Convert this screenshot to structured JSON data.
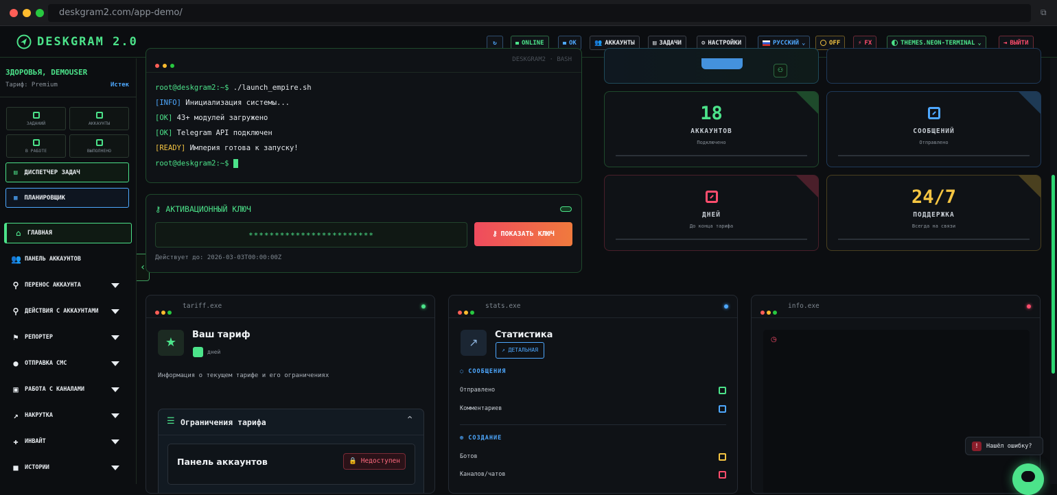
{
  "browser": {
    "url": "deskgram2.com/app-demo/"
  },
  "app": {
    "logo_text": "DESKGRAM 2.0"
  },
  "header": {
    "online": "ONLINE",
    "ok": "OK",
    "accounts": "АККАУНТЫ",
    "tasks": "ЗАДАЧИ",
    "settings": "НАСТРОЙКИ",
    "language": "РУССКИЙ",
    "off": "OFF",
    "fx": "FX",
    "theme": "THEMES.NEON-TERMINAL",
    "logout": "ВЫЙТИ"
  },
  "sidebar": {
    "greeting": "ЗДОРОВЬЯ, DEMOUSER",
    "plan": "Тариф: Premium",
    "plan_link": "Истек",
    "stats": [
      {
        "label": "ЗАДАНИЙ"
      },
      {
        "label": "АККАУНТЫ"
      },
      {
        "label": "В РАБОТЕ"
      },
      {
        "label": "ВЫПОЛНЕНО"
      }
    ],
    "dispatcher": "ДИСПЕТЧЕР ЗАДАЧ",
    "scheduler": "ПЛАНИРОВЩИК",
    "nav": [
      {
        "label": "ГЛАВНАЯ",
        "icon": "home-icon"
      },
      {
        "label": "ПАНЕЛЬ АККАУНТОВ",
        "icon": "users-icon"
      },
      {
        "label": "ПЕРЕНОС АККАУНТА",
        "icon": "user-transfer-icon"
      },
      {
        "label": "ДЕЙСТВИЯ С АККАУНТАМИ",
        "icon": "user-minus-icon"
      },
      {
        "label": "РЕПОРТЕР",
        "icon": "flag-icon"
      },
      {
        "label": "ОТПРАВКА СМС",
        "icon": "chat-icon"
      },
      {
        "label": "РАБОТА С КАНАЛАМИ",
        "icon": "briefcase-icon"
      },
      {
        "label": "НАКРУТКА",
        "icon": "chart-line-icon"
      },
      {
        "label": "ИНВАЙТ",
        "icon": "user-plus-icon"
      },
      {
        "label": "ИСТОРИИ",
        "icon": "camera-icon"
      }
    ]
  },
  "terminal": {
    "title_right": "DESKGRAM2 · BASH",
    "lines": [
      {
        "prefix": "root@deskgram2:~$ ",
        "text": "./launch_empire.sh"
      },
      {
        "prefix": "[INFO] ",
        "text": "Инициализация системы..."
      },
      {
        "prefix": "[OK] ",
        "text": "43+ модулей загружено"
      },
      {
        "prefix": "[OK] ",
        "text": "Telegram API подключен"
      },
      {
        "prefix": "[READY] ",
        "text": "Империя готова к запуску!"
      },
      {
        "prefix": "root@deskgram2:~$ ",
        "text": ""
      }
    ]
  },
  "activation": {
    "title": "АКТИВАЦИОННЫЙ КЛЮЧ",
    "key": "************************",
    "button": "ПОКАЗАТЬ КЛЮЧ",
    "valid": "Действует до: 2026-03-03T00:00:00Z"
  },
  "stats": [
    {
      "value": "18",
      "label": "АККАУНТОВ",
      "sub": "Подключено",
      "color": "#4ce38a"
    },
    {
      "value": "",
      "label": "СООБЩЕНИЙ",
      "sub": "Отправлено",
      "color": "#4ea8ff"
    },
    {
      "value": "",
      "label": "ДНЕЙ",
      "sub": "До конца тарифа",
      "color": "#ff4d6d"
    },
    {
      "value": "24/7",
      "label": "ПОДДЕРЖКА",
      "sub": "Всегда на связи",
      "color": "#f5c542"
    }
  ],
  "tariff": {
    "window": "tariff.exe",
    "title": "Ваш тариф",
    "days": "дней",
    "desc": "Информация о текущем тарифе и его ограничениях",
    "limits_title": "Ограничения тарифа",
    "item": "Панель аккаунтов",
    "badge": "Недоступен"
  },
  "statistics": {
    "window": "stats.exe",
    "title": "Статистика",
    "detail_btn": "ДЕТАЛЬНАЯ",
    "messages_head": "СООБЩЕНИЯ",
    "sent": "Отправлено",
    "comments": "Комментариев",
    "create_head": "СОЗДАНИЕ",
    "bots": "Ботов",
    "channels": "Каналов/чатов"
  },
  "info": {
    "window": "info.exe"
  },
  "bug": {
    "label": "Нашёл ошибку?"
  }
}
